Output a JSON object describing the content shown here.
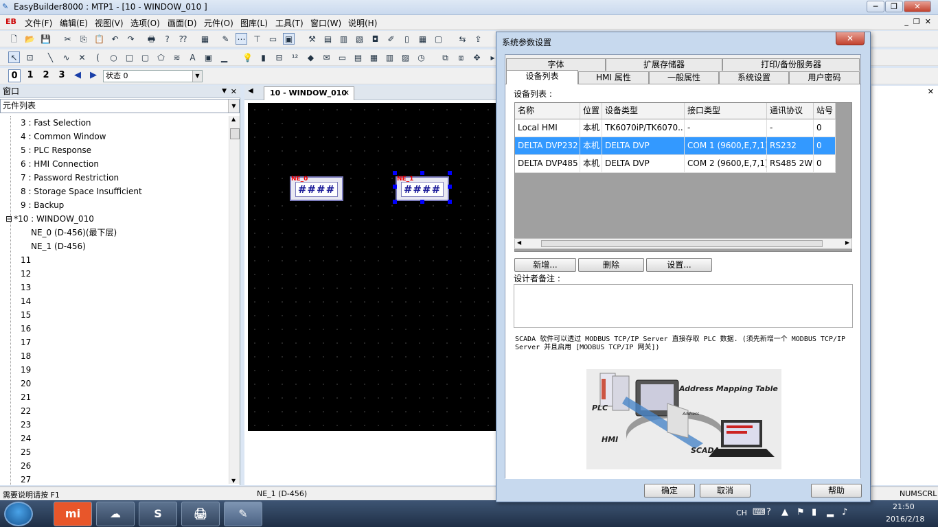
{
  "app": {
    "title": "EasyBuilder8000 : MTP1 - [10 - WINDOW_010 ]",
    "logo": "EB"
  },
  "window_controls": {
    "minimize": "─",
    "restore": "❐",
    "close": "✕"
  },
  "menu": [
    "文件(F)",
    "编辑(E)",
    "视图(V)",
    "选项(O)",
    "画面(D)",
    "元件(O)",
    "图库(L)",
    "工具(T)",
    "窗口(W)",
    "说明(H)"
  ],
  "mdi_controls": {
    "minimize": "_",
    "restore": "❐",
    "close": "✕"
  },
  "state_bar": {
    "states": [
      "0",
      "1",
      "2",
      "3"
    ],
    "selected": "0",
    "combo_value": "状态 0"
  },
  "left_panel": {
    "title": "窗口",
    "pin": "▼",
    "close": "✕",
    "select_value": "元件列表",
    "tree": [
      {
        "label": "3 : Fast Selection",
        "level": 1
      },
      {
        "label": "4 : Common Window",
        "level": 1
      },
      {
        "label": "5 : PLC Response",
        "level": 1
      },
      {
        "label": "6 : HMI Connection",
        "level": 1
      },
      {
        "label": "7 : Password Restriction",
        "level": 1
      },
      {
        "label": "8 : Storage Space Insufficient",
        "level": 1
      },
      {
        "label": "9 : Backup",
        "level": 1
      },
      {
        "label": "*10 : WINDOW_010",
        "level": 0,
        "expander": "⊟"
      },
      {
        "label": "NE_0 (D-456)(最下层)",
        "level": 2
      },
      {
        "label": "NE_1 (D-456)",
        "level": 2
      },
      {
        "label": "11",
        "level": 1
      },
      {
        "label": "12",
        "level": 1
      },
      {
        "label": "13",
        "level": 1
      },
      {
        "label": "14",
        "level": 1
      },
      {
        "label": "15",
        "level": 1
      },
      {
        "label": "16",
        "level": 1
      },
      {
        "label": "17",
        "level": 1
      },
      {
        "label": "18",
        "level": 1
      },
      {
        "label": "19",
        "level": 1
      },
      {
        "label": "20",
        "level": 1
      },
      {
        "label": "21",
        "level": 1
      },
      {
        "label": "22",
        "level": 1
      },
      {
        "label": "23",
        "level": 1
      },
      {
        "label": "24",
        "level": 1
      },
      {
        "label": "25",
        "level": 1
      },
      {
        "label": "26",
        "level": 1
      },
      {
        "label": "27",
        "level": 1
      }
    ]
  },
  "doc": {
    "tab_label": "10 - WINDOW_010",
    "tab_close": "✕",
    "elements": [
      {
        "label": "NE_0",
        "text": "####"
      },
      {
        "label": "NE_1",
        "text": "####"
      }
    ]
  },
  "status": {
    "help": "需要说明请按 F1",
    "selection": "NE_1 (D-456)",
    "num": "NUM",
    "scrl": "SCRL"
  },
  "dialog": {
    "title": "系统参数设置",
    "close": "✕",
    "tabs_row1": [
      "字体",
      "扩展存储器",
      "打印/备份服务器"
    ],
    "tabs_row2": [
      "设备列表",
      "HMI 属性",
      "一般属性",
      "系统设置",
      "用户密码"
    ],
    "active_tab": "设备列表",
    "device_list_label": "设备列表 :",
    "columns": [
      "名称",
      "位置",
      "设备类型",
      "接口类型",
      "通讯协议",
      "站号"
    ],
    "rows": [
      [
        "Local HMI",
        "本机",
        "TK6070iP/TK6070...",
        "-",
        "-",
        "0"
      ],
      [
        "DELTA DVP232",
        "本机",
        "DELTA DVP",
        "COM 1 (9600,E,7,1)",
        "RS232",
        "0"
      ],
      [
        "DELTA DVP485",
        "本机",
        "DELTA DVP",
        "COM 2 (9600,E,7,1)",
        "RS485 2W",
        "0"
      ]
    ],
    "selected_row": 1,
    "buttons": {
      "add": "新增...",
      "delete": "删除",
      "settings": "设置..."
    },
    "note_label": "设计者备注 :",
    "note_value": "",
    "scada_text": "SCADA 软件可以透过 MODBUS TCP/IP Server 直接存取 PLC 数据. (须先新增一个 MODBUS TCP/IP Server 并且启用 [MODBUS TCP/IP 网关])",
    "diagram_labels": {
      "mapping": "Address Mapping Table",
      "plc": "PLC",
      "hmi": "HMI",
      "scada": "SCADA",
      "address": "Address"
    },
    "ok": "确定",
    "cancel": "取消",
    "help": "帮助"
  },
  "taskbar": {
    "apps": [
      {
        "name": "xiaomi",
        "glyph": "mi"
      },
      {
        "name": "cloud",
        "glyph": "☁"
      },
      {
        "name": "sogou",
        "glyph": "S"
      },
      {
        "name": "printer",
        "glyph": "🖨"
      },
      {
        "name": "easybuilder",
        "glyph": "✎"
      }
    ],
    "lang": "CH",
    "time": "21:50",
    "date": "2016/2/18"
  }
}
